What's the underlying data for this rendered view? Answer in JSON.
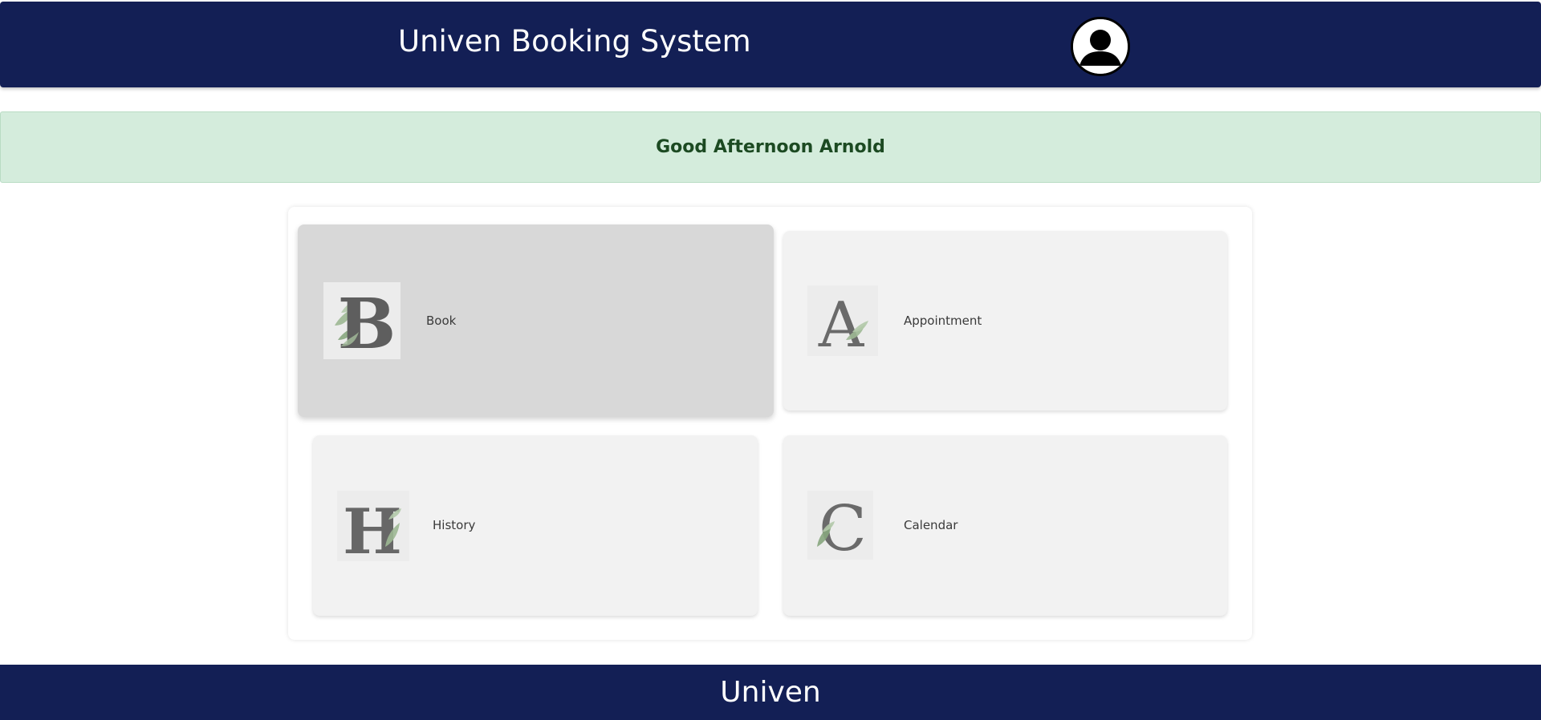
{
  "header": {
    "title": "Univen Booking System",
    "avatar_icon": "user-avatar-icon"
  },
  "greeting": {
    "text": "Good Afternoon Arnold"
  },
  "menu": {
    "items": [
      {
        "letter": "B",
        "label": "Book",
        "icon": "letter-b-leaf-icon",
        "active": true
      },
      {
        "letter": "A",
        "label": "Appointment",
        "icon": "letter-a-leaf-icon",
        "active": false
      },
      {
        "letter": "H",
        "label": "History",
        "icon": "letter-h-leaf-icon",
        "active": false
      },
      {
        "letter": "C",
        "label": "Calendar",
        "icon": "letter-c-leaf-icon",
        "active": false
      }
    ]
  },
  "footer": {
    "text": "Univen"
  },
  "colors": {
    "navy": "#131f55",
    "greeting_bg": "#d4ecdc",
    "greeting_text": "#1c4a22",
    "card_bg": "#f2f2f2",
    "card_active_bg": "#d8d8d8",
    "leaf_green": "#8fae86"
  }
}
